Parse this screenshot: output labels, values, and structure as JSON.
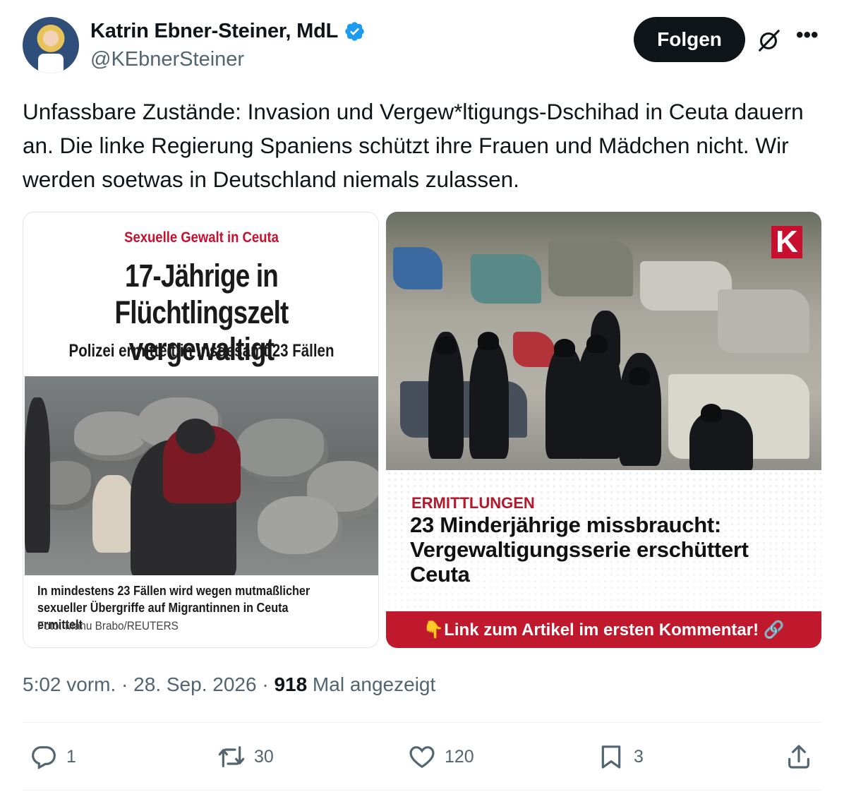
{
  "author": {
    "name": "Katrin Ebner-Steiner, MdL",
    "handle": "@KEbnerSteiner",
    "verified_color": "#1d9bf0"
  },
  "header": {
    "follow_label": "Folgen",
    "grok_icon": "grok-slash-icon",
    "more_icon": "more-icon"
  },
  "tweet": {
    "text": "Unfassbare Zustände: Invasion und Vergew*ltigungs-Dschihad in Ceuta dauern an. Die linke Regierung Spaniens schützt ihre Frauen und Mädchen nicht. Wir werden soetwas in Deutschland niemals zulassen."
  },
  "media": {
    "left": {
      "kicker": "Sexuelle Gewalt in Ceuta",
      "headline": "17-Jährige in Flüchtlingszelt vergewaltigt",
      "subheadline": "Polizei ermittelt in insgesamt 23 Fällen",
      "caption": "In mindestens 23 Fällen wird wegen mutmaßlicher sexueller Übergriffe auf Migrantinnen in Ceuta ermittelt",
      "credit": "Foto: Manu Brabo/REUTERS",
      "accent": "#c8102e"
    },
    "right": {
      "logo": "K",
      "kicker": "ERMITTLUNGEN",
      "headline": "23 Minderjährige missbraucht: Vergewaltigungsserie erschüttert Ceuta",
      "cta": "👇Link zum Artikel im ersten Kommentar! 🔗",
      "accent": "#c0182c"
    }
  },
  "meta": {
    "time": "5:02 vorm.",
    "separator": " · ",
    "date": "28. Sep. 2026",
    "views_count": "918",
    "views_label": " Mal angezeigt"
  },
  "actions": {
    "replies": "1",
    "reposts": "30",
    "likes": "120",
    "bookmarks": "3"
  }
}
